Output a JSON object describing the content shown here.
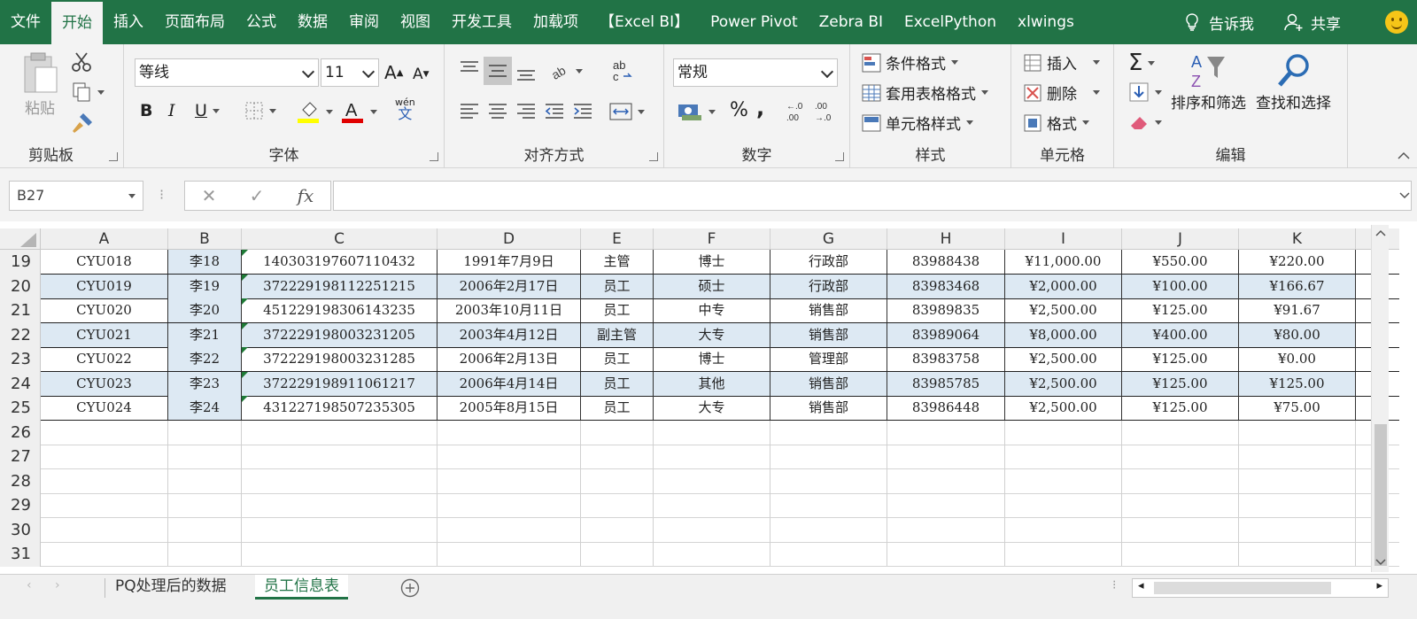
{
  "menu": {
    "tabs": [
      "文件",
      "开始",
      "插入",
      "页面布局",
      "公式",
      "数据",
      "审阅",
      "视图",
      "开发工具",
      "加载项",
      "【Excel BI】",
      "Power Pivot",
      "Zebra BI",
      "ExcelPython",
      "xlwings"
    ],
    "active_tab": "开始",
    "tell_me": "告诉我",
    "share": "共享"
  },
  "ribbon": {
    "clipboard": {
      "label": "剪贴板",
      "paste": "粘贴"
    },
    "font": {
      "label": "字体",
      "name": "等线",
      "size": "11",
      "bold": "B",
      "italic": "I",
      "underline": "U",
      "phonetic_top": "wén",
      "phonetic_bottom": "文"
    },
    "alignment": {
      "label": "对齐方式"
    },
    "number": {
      "label": "数字",
      "format": "常规",
      "percent": "%",
      "comma": ","
    },
    "styles": {
      "label": "样式",
      "conditional": "条件格式",
      "table": "套用表格格式",
      "cell_styles": "单元格样式"
    },
    "cells": {
      "label": "单元格",
      "insert": "插入",
      "delete": "删除",
      "format": "格式"
    },
    "editing": {
      "label": "编辑",
      "sort_filter": "排序和筛选",
      "find_select": "查找和选择"
    }
  },
  "formula_bar": {
    "name_box": "B27",
    "fx": "fx",
    "formula": ""
  },
  "columns": [
    "A",
    "B",
    "C",
    "D",
    "E",
    "F",
    "G",
    "H",
    "I",
    "J",
    "K"
  ],
  "rows": [
    {
      "num": "19",
      "cells": [
        "CYU018",
        "李18",
        "140303197607110432",
        "1991年7月9日",
        "主管",
        "博士",
        "行政部",
        "83988438",
        "¥11,000.00",
        "¥550.00",
        "¥220.00"
      ]
    },
    {
      "num": "20",
      "cells": [
        "CYU019",
        "李19",
        "372229198112251215",
        "2006年2月17日",
        "员工",
        "硕士",
        "行政部",
        "83983468",
        "¥2,000.00",
        "¥100.00",
        "¥166.67"
      ]
    },
    {
      "num": "21",
      "cells": [
        "CYU020",
        "李20",
        "451229198306143235",
        "2003年10月11日",
        "员工",
        "中专",
        "销售部",
        "83989835",
        "¥2,500.00",
        "¥125.00",
        "¥91.67"
      ]
    },
    {
      "num": "22",
      "cells": [
        "CYU021",
        "李21",
        "372229198003231205",
        "2003年4月12日",
        "副主管",
        "大专",
        "销售部",
        "83989064",
        "¥8,000.00",
        "¥400.00",
        "¥80.00"
      ]
    },
    {
      "num": "23",
      "cells": [
        "CYU022",
        "李22",
        "372229198003231285",
        "2006年2月13日",
        "员工",
        "博士",
        "管理部",
        "83983758",
        "¥2,500.00",
        "¥125.00",
        "¥0.00"
      ]
    },
    {
      "num": "24",
      "cells": [
        "CYU023",
        "李23",
        "372229198911061217",
        "2006年4月14日",
        "员工",
        "其他",
        "销售部",
        "83985785",
        "¥2,500.00",
        "¥125.00",
        "¥125.00"
      ]
    },
    {
      "num": "25",
      "cells": [
        "CYU024",
        "李24",
        "431227198507235305",
        "2005年8月15日",
        "员工",
        "大专",
        "销售部",
        "83986448",
        "¥2,500.00",
        "¥125.00",
        "¥75.00"
      ]
    }
  ],
  "empty_rows": [
    "26",
    "27",
    "28",
    "29",
    "30",
    "31"
  ],
  "sheets": [
    "PQ处理后的数据",
    "员工信息表"
  ],
  "active_sheet": "员工信息表",
  "colors": {
    "accent": "#217346",
    "band": "#dde9f3",
    "text_marker": "#1e7a36"
  }
}
